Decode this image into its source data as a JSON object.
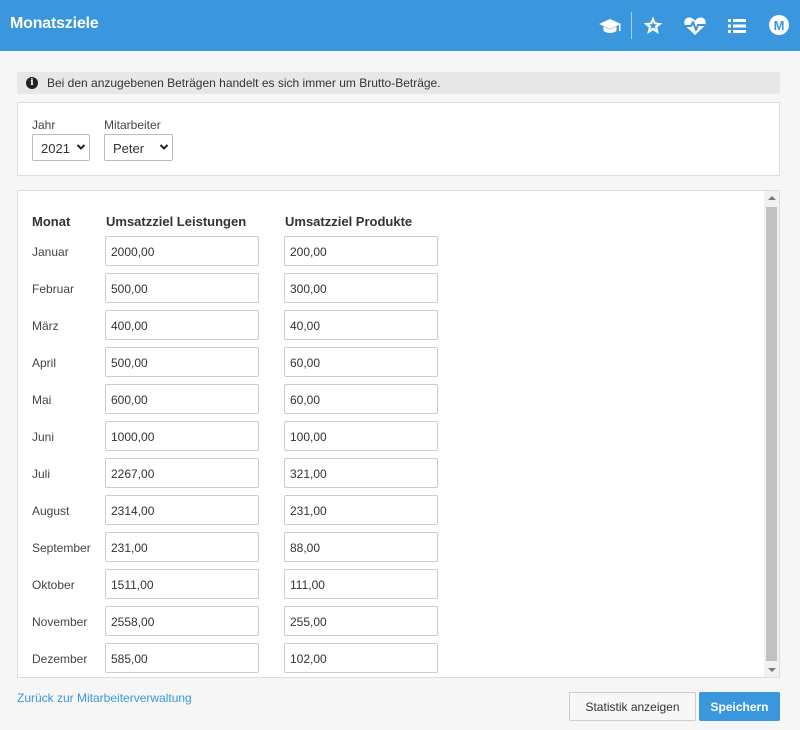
{
  "header": {
    "title": "Monatsziele",
    "icons": [
      "graduation-cap-icon",
      "star-icon",
      "heartbeat-icon",
      "list-icon"
    ],
    "avatar_initial": "M",
    "background": "#3a97dd"
  },
  "info_banner": {
    "text": "Bei den anzugebenen Beträgen handelt es sich immer um Brutto-Beträge.",
    "icon": "info-circle-icon"
  },
  "filters": {
    "year_label": "Jahr",
    "year_value": "2021",
    "employee_label": "Mitarbeiter",
    "employee_value": "Peter"
  },
  "table": {
    "headers": [
      "Monat",
      "Umsatzziel Leistungen",
      "Umsatzziel Produkte"
    ],
    "rows": [
      {
        "month": "Januar",
        "services": "2000,00",
        "products": "200,00"
      },
      {
        "month": "Februar",
        "services": "500,00",
        "products": "300,00"
      },
      {
        "month": "März",
        "services": "400,00",
        "products": "40,00"
      },
      {
        "month": "April",
        "services": "500,00",
        "products": "60,00"
      },
      {
        "month": "Mai",
        "services": "600,00",
        "products": "60,00"
      },
      {
        "month": "Juni",
        "services": "1000,00",
        "products": "100,00"
      },
      {
        "month": "Juli",
        "services": "2267,00",
        "products": "321,00"
      },
      {
        "month": "August",
        "services": "2314,00",
        "products": "231,00"
      },
      {
        "month": "September",
        "services": "231,00",
        "products": "88,00"
      },
      {
        "month": "Oktober",
        "services": "1511,00",
        "products": "111,00"
      },
      {
        "month": "November",
        "services": "2558,00",
        "products": "255,00"
      },
      {
        "month": "Dezember",
        "services": "585,00",
        "products": "102,00"
      }
    ]
  },
  "footer": {
    "back_link": "Zurück zur Mitarbeiterverwaltung",
    "stats_button": "Statistik anzeigen",
    "save_button": "Speichern"
  }
}
